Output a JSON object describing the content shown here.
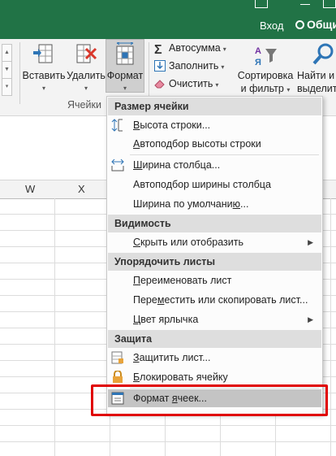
{
  "titlebar": {
    "login": "Вход",
    "share": "Общий"
  },
  "ribbon": {
    "insert": "Вставить",
    "delete": "Удалить",
    "format": "Формат",
    "cells_group": "Ячейки",
    "autosum": "Автосумма",
    "fill": "Заполнить",
    "clear": "Очистить",
    "sort_l1": "Сортировка",
    "sort_l2": "и фильтр",
    "find_l1": "Найти и",
    "find_l2": "выделить",
    "dd": "▾"
  },
  "columns": [
    "W",
    "X"
  ],
  "menu": {
    "sec_size": "Размер ячейки",
    "row_height": [
      "В",
      "ысота строки..."
    ],
    "autofit_row": [
      "",
      "А",
      "втоподбор высоты строки"
    ],
    "col_width": [
      "",
      "Ш",
      "ирина столбца..."
    ],
    "autofit_col": [
      "Автопо",
      "д",
      "бор ширины столбца"
    ],
    "default_width": [
      "Ширина по умолчани",
      "ю",
      "..."
    ],
    "sec_visibility": "Видимость",
    "hide_show": [
      "",
      "С",
      "крыть или отобразить"
    ],
    "sec_arrange": "Упорядочить листы",
    "rename": [
      "",
      "П",
      "ереименовать лист"
    ],
    "move_copy": [
      "Пере",
      "м",
      "естить или скопировать лист..."
    ],
    "tab_color": [
      "",
      "Ц",
      "вет ярлычка"
    ],
    "sec_protect": "Защита",
    "protect_sheet": [
      "",
      "З",
      "ащитить лист..."
    ],
    "lock_cell": [
      "",
      "Б",
      "локировать ячейку"
    ],
    "format_cells": [
      "Формат ",
      "я",
      "чеек..."
    ]
  }
}
